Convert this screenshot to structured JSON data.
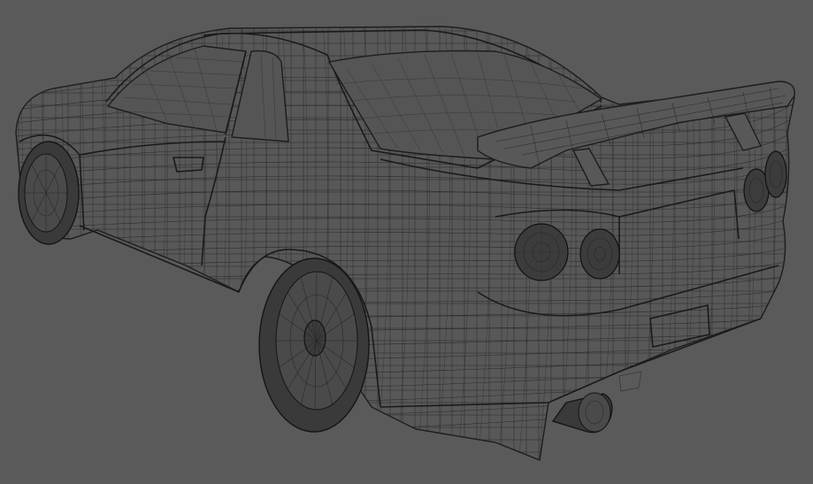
{
  "scene": {
    "subject": "car-wireframe-model",
    "background_color": "#5a5a5a",
    "wire_color": "#222222"
  }
}
